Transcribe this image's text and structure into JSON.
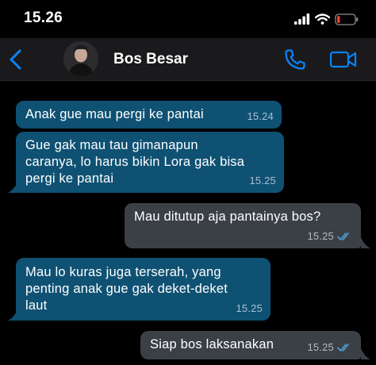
{
  "status_bar": {
    "time": "15.26"
  },
  "header": {
    "contact_name": "Bos Besar",
    "icons": [
      "chevron-left-icon",
      "phone-icon",
      "video-camera-icon"
    ],
    "accent_color": "#0a84ff"
  },
  "messages": [
    {
      "direction": "in",
      "text": "Anak gue mau pergi ke pantai",
      "time": "15.24"
    },
    {
      "direction": "in",
      "text": "Gue gak mau tau gimanapun\ncaranya, lo harus bikin Lora gak bisa\npergi ke pantai",
      "time": "15.25"
    },
    {
      "direction": "out",
      "text": "Mau ditutup aja pantainya bos?",
      "time": "15.25",
      "status": "read"
    },
    {
      "direction": "in",
      "text": "Mau lo kuras juga terserah, yang\npenting anak gue gak deket-deket\nlaut",
      "time": "15.25"
    },
    {
      "direction": "out",
      "text": "Siap bos laksanakan",
      "time": "15.25",
      "status": "read"
    }
  ],
  "colors": {
    "incoming_bubble": "#0f5173",
    "outgoing_bubble": "#3a4046",
    "read_ticks": "#4fa3e0",
    "battery_low": "#ff3b30"
  }
}
